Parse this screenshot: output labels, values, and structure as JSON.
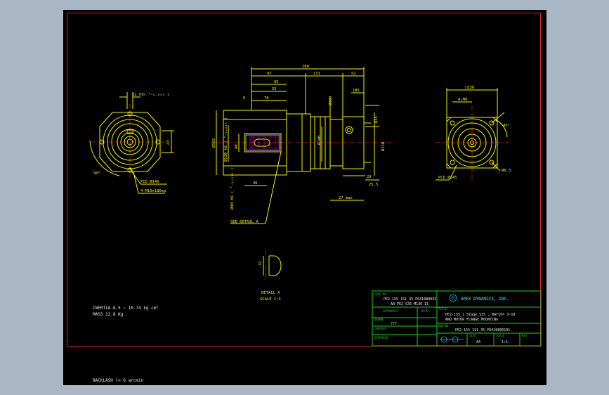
{
  "dimensions": {
    "overall_length": "280",
    "d97": "97",
    "d131": "131",
    "d52": "52",
    "d95": "95",
    "d55": "55",
    "d70": "70",
    "d6": "6",
    "dia180": "Ø180",
    "d185": "185",
    "dia35": "Ø35",
    "dia110": "Ø110",
    "dia140": "Ø140",
    "dia152": "Ø152",
    "d20": "20",
    "d255": "25.5",
    "d27": "27 max",
    "d36": "36",
    "d40": "40",
    "keyway": "12 h9( ⁰₋₀.₀₄₃ )",
    "dia40h6": "Ø40 h6 ( ⁰₋₀.₀₁₆ )",
    "dia130h6": "Ø130 h6 ( ⁰₋₀.₀₂₅ )",
    "d43": "43",
    "d90": "90°",
    "pcd_left": "PCD Ø140",
    "holes_left": "4-M10x18Dep",
    "right_square": "□130",
    "right_holes": "4-M8",
    "angle45": "45°",
    "pcd_right": "PCD Ø145",
    "dia63": "Ø6.3"
  },
  "labels": {
    "see_detail": "SEE DETAIL A",
    "detail_title": "DETAIL A",
    "detail_scale": "SCALE 1:4",
    "detail_dim": "37"
  },
  "notes": {
    "inertia": "INERTIA 8.5 ~ 10.74 kg-cm²",
    "mass": "MASS 12.8 Kg",
    "backlash": "BACKLASH (= 6 arcmin"
  },
  "title_block": {
    "part_no_label": "PART NO.",
    "part_no_1": "PE2-155_1S1_35-P0410800XX",
    "part_no_2": "AB-PE2-S35-M130-II",
    "approval_label": "APPROVALS",
    "date_label": "DATE",
    "drawn_label": "DRAWN",
    "drawn_value": "???",
    "checked_label": "CHECKED",
    "approved_label": "APPROVED",
    "company": "APEX DYNAMICS, INC.",
    "title_label": "TITLE",
    "title_1": "PE2-155_1 Stage_S35 , RATIO= 3~10",
    "title_2": "AND MOTOR FLANGE MOUNTING",
    "dwg_label": "DWG NO.",
    "dwg_value": "PE2-155_1S1_35-P0410800101",
    "size_label": "SIZE",
    "size_value": "A4",
    "scale_label": "SCALE",
    "scale_value": "1:1",
    "rev_label": "REV"
  },
  "colors": {
    "background": "#000000",
    "geometry": "#f2f200",
    "title_block": "#18d018",
    "frame": "#e02020",
    "centerline": "#e02020"
  }
}
